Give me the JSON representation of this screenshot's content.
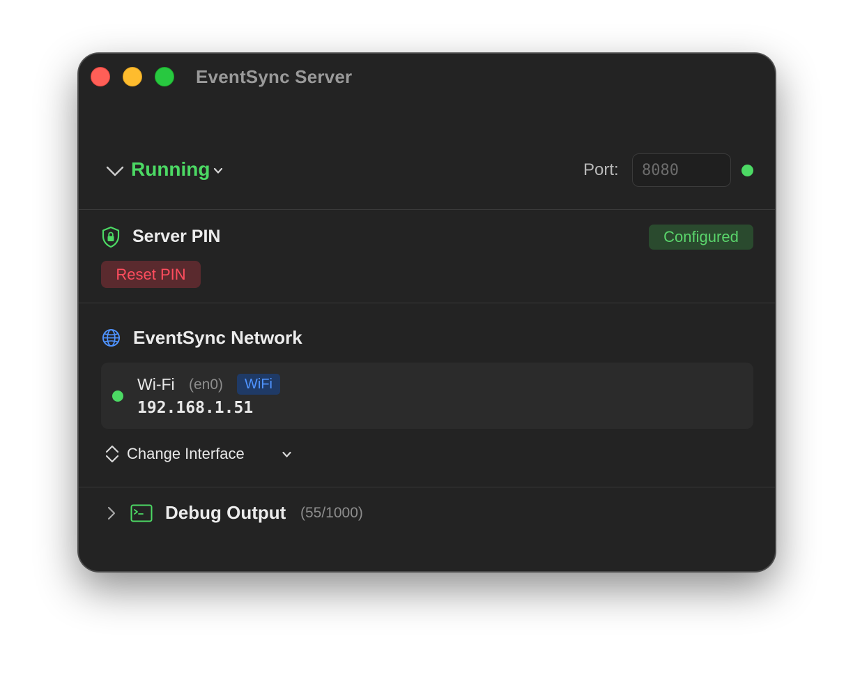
{
  "window": {
    "title": "EventSync Server"
  },
  "status": {
    "label": "Running",
    "port_label": "Port:",
    "port_placeholder": "8080",
    "port_value": "",
    "indicator_color": "#4cd964"
  },
  "pin": {
    "title": "Server PIN",
    "badge": "Configured",
    "reset_label": "Reset PIN",
    "icon": "shield-lock-icon"
  },
  "network": {
    "title": "EventSync Network",
    "icon": "globe-icon",
    "interface": {
      "name": "Wi-Fi",
      "device": "(en0)",
      "type_badge": "WiFi",
      "ip": "192.168.1.51",
      "status_color": "#4cd964"
    },
    "change_label": "Change Interface"
  },
  "debug": {
    "title": "Debug Output",
    "count": "(55/1000)",
    "icon": "terminal-icon"
  },
  "colors": {
    "accent_green": "#4cd964",
    "danger_red": "#ff4d5e",
    "info_blue": "#4f93ff",
    "window_bg": "#232323"
  }
}
